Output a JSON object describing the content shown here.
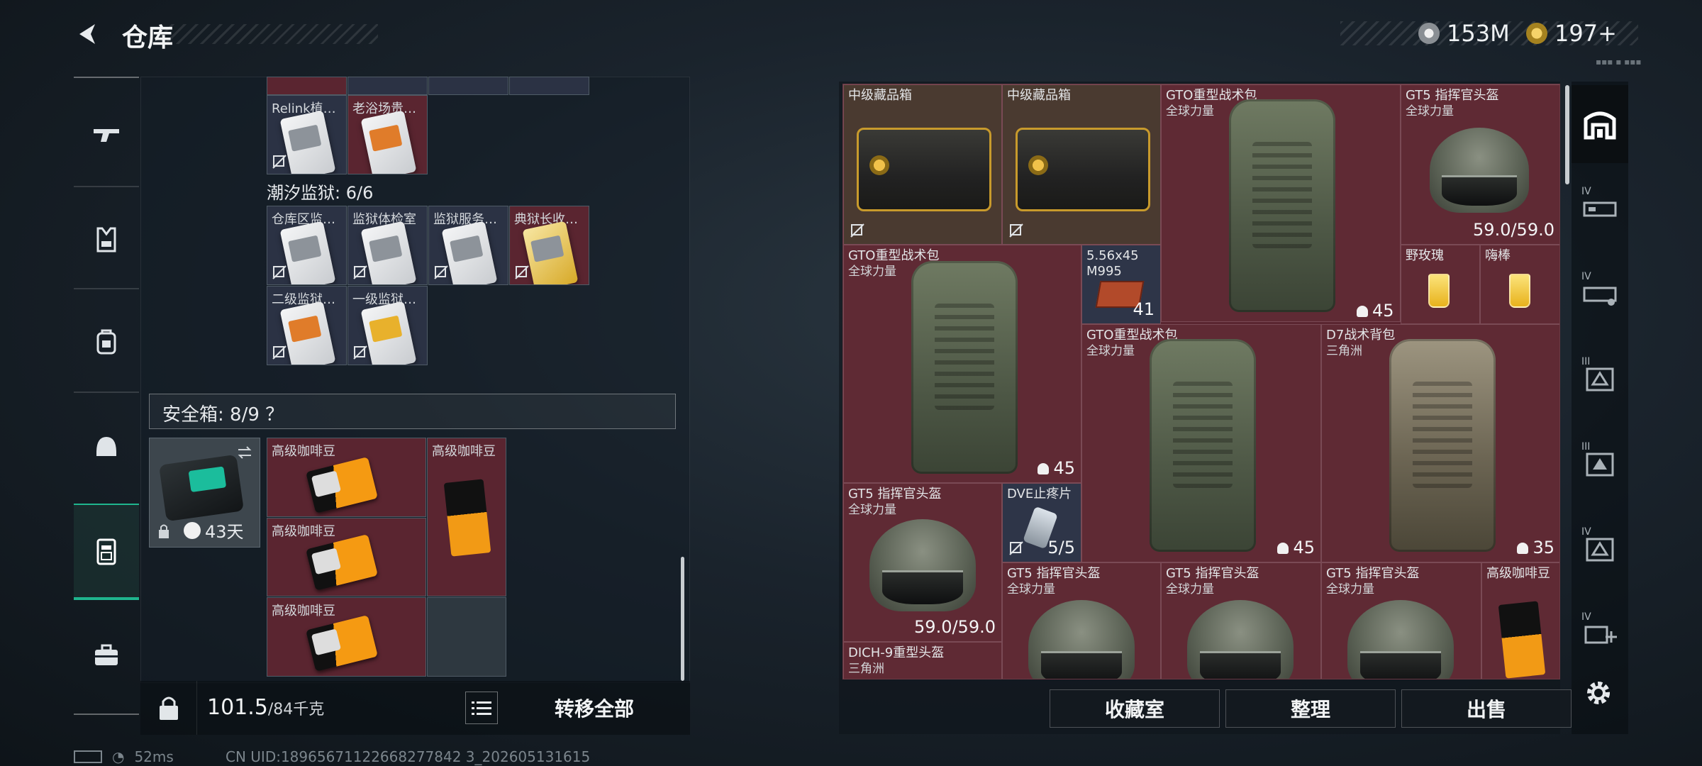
{
  "header": {
    "title": "仓库",
    "currency_a": "153M",
    "currency_b": "197+"
  },
  "nav": {
    "items": [
      "weapons",
      "armor",
      "backpack",
      "helmet",
      "safe-box",
      "toolbox"
    ],
    "active": "safe-box"
  },
  "left": {
    "top_cells": [
      {
        "label": "Relink植…"
      },
      {
        "label": "老浴场贵…"
      }
    ],
    "section_label": "潮汐监狱: 6/6",
    "prison_cells": [
      {
        "label": "仓库区监…"
      },
      {
        "label": "监狱体检室"
      },
      {
        "label": "监狱服务…"
      },
      {
        "label": "典狱长收…"
      },
      {
        "label": "二级监狱…"
      },
      {
        "label": "一级监狱…"
      }
    ],
    "safe_header": "安全箱: 8/9 ？",
    "safe_box": {
      "days": "43天"
    },
    "safe_items": [
      {
        "label": "高级咖啡豆"
      },
      {
        "label": "高级咖啡豆"
      },
      {
        "label": "高级咖啡豆"
      },
      {
        "label": "高级咖啡豆"
      }
    ],
    "weight_value": "101.5",
    "weight_unit": "/84千克",
    "transfer_all": "转移全部"
  },
  "right": {
    "items": [
      {
        "name": "中级藏品箱"
      },
      {
        "name": "中级藏品箱"
      },
      {
        "name": "GTO重型战术包",
        "sub": "全球力量"
      },
      {
        "name": "GT5 指挥官头盔",
        "sub": "全球力量",
        "durability": "59.0/59.0"
      },
      {
        "name": "GTO重型战术包",
        "sub": "全球力量",
        "weight": "45"
      },
      {
        "name": "5.56x45 M995",
        "count": "41"
      },
      {
        "weight_b": "45"
      },
      {
        "name": "野玫瑰"
      },
      {
        "name": "嗨棒"
      },
      {
        "name": "GTO重型战术包",
        "sub": "全球力量",
        "weight": "45"
      },
      {
        "name": "D7战术背包",
        "sub": "三角洲",
        "weight": "35"
      },
      {
        "name": "GT5 指挥官头盔",
        "sub": "全球力量",
        "durability": "59.0/59.0"
      },
      {
        "name": "DVE止疼片",
        "count": "5/5"
      },
      {
        "name": "GT5 指挥官头盔",
        "sub": "全球力量"
      },
      {
        "name": "GT5 指挥官头盔",
        "sub": "全球力量"
      },
      {
        "name": "GT5 指挥官头盔",
        "sub": "全球力量"
      },
      {
        "name": "高级咖啡豆"
      },
      {
        "name": "DICH-9重型头盔",
        "sub": "三角洲"
      }
    ],
    "tabs": [
      {
        "level": ""
      },
      {
        "level": "IV"
      },
      {
        "level": "IV"
      },
      {
        "level": "III"
      },
      {
        "level": "III"
      },
      {
        "level": "IV"
      },
      {
        "level": "IV"
      }
    ],
    "buttons": {
      "collection": "收藏室",
      "organize": "整理",
      "sell": "出售"
    }
  },
  "status": {
    "ping": "52ms",
    "uid": "CN UID:18965671122668277842 3_202605131615"
  },
  "colors": {
    "accent": "#1fb58e",
    "item_red": "#5a2530",
    "item_blue": "#2b3244"
  }
}
